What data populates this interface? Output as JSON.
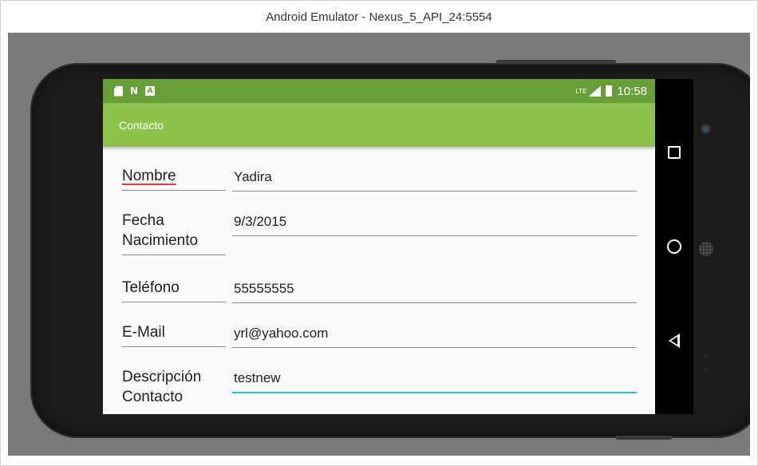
{
  "window": {
    "title": "Android Emulator - Nexus_5_API_24:5554"
  },
  "statusbar": {
    "network": "LTE",
    "time": "10:58",
    "icons_left": [
      "sd-card-icon",
      "n-icon",
      "a-notification-icon"
    ]
  },
  "appbar": {
    "title": "Contacto"
  },
  "form": {
    "fields": [
      {
        "label": "Nombre",
        "value": "Yadira"
      },
      {
        "label_line1": "Fecha",
        "label_line2": "Nacimiento",
        "value": "9/3/2015"
      },
      {
        "label": "Teléfono",
        "value": "55555555"
      },
      {
        "label": "E-Mail",
        "value": "yrl@yahoo.com"
      },
      {
        "label_line1": "Descripción",
        "label_line2": "Contacto",
        "value": "testnew"
      }
    ]
  },
  "navbar": {
    "buttons": [
      "recents-icon",
      "home-icon",
      "back-icon"
    ]
  },
  "colors": {
    "statusbar": "#689f38",
    "appbar": "#8bc34a",
    "focus_underline": "#26c6da",
    "spell_underline": "#e53935"
  }
}
